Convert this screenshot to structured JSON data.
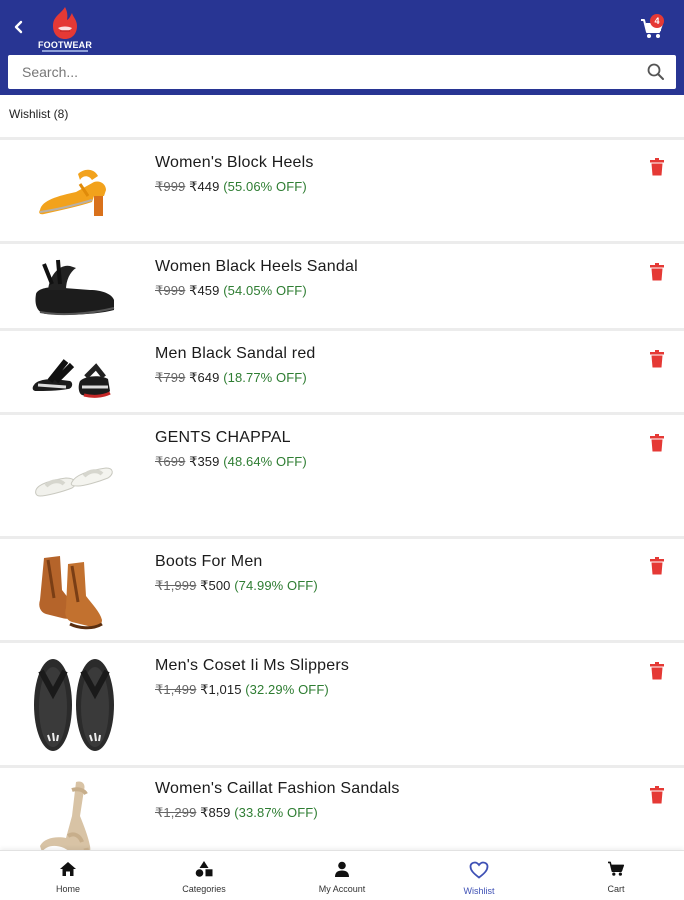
{
  "header": {
    "brand": "FOOTWEAR",
    "cart_count": "4",
    "colors": {
      "bar": "#283593",
      "badge": "#e53935"
    }
  },
  "search": {
    "placeholder": "Search..."
  },
  "wishlist": {
    "heading": "Wishlist (8)",
    "items": [
      {
        "name": "Women's Block Heels",
        "mrp": "₹999",
        "price": "₹449",
        "discount": "(55.06% OFF)",
        "image_icon": "block-heel-sandal-icon"
      },
      {
        "name": "Women Black Heels Sandal",
        "mrp": "₹999",
        "price": "₹459",
        "discount": "(54.05% OFF)",
        "image_icon": "black-wedge-sandal-icon"
      },
      {
        "name": "Men Black Sandal red",
        "mrp": "₹799",
        "price": "₹649",
        "discount": "(18.77% OFF)",
        "image_icon": "men-sandal-icon"
      },
      {
        "name": "GENTS CHAPPAL",
        "mrp": "₹699",
        "price": "₹359",
        "discount": "(48.64% OFF)",
        "image_icon": "white-chappal-icon"
      },
      {
        "name": "Boots For Men",
        "mrp": "₹1,999",
        "price": "₹500",
        "discount": "(74.99% OFF)",
        "image_icon": "brown-boot-icon"
      },
      {
        "name": "Men's Coset Ii Ms Slippers",
        "mrp": "₹1,499",
        "price": "₹1,015",
        "discount": "(32.29% OFF)",
        "image_icon": "slipper-icon"
      },
      {
        "name": "Women's Caillat Fashion Sandals",
        "mrp": "₹1,299",
        "price": "₹859",
        "discount": "(33.87% OFF)",
        "image_icon": "ankle-strap-heel-icon"
      }
    ]
  },
  "bottom_nav": {
    "home": "Home",
    "categories": "Categories",
    "account": "My Account",
    "wishlist": "Wishlist",
    "cart": "Cart",
    "active": "wishlist",
    "active_color": "#3f51b5"
  },
  "accent_colors": {
    "discount": "#2e7d32",
    "delete": "#e53935"
  }
}
